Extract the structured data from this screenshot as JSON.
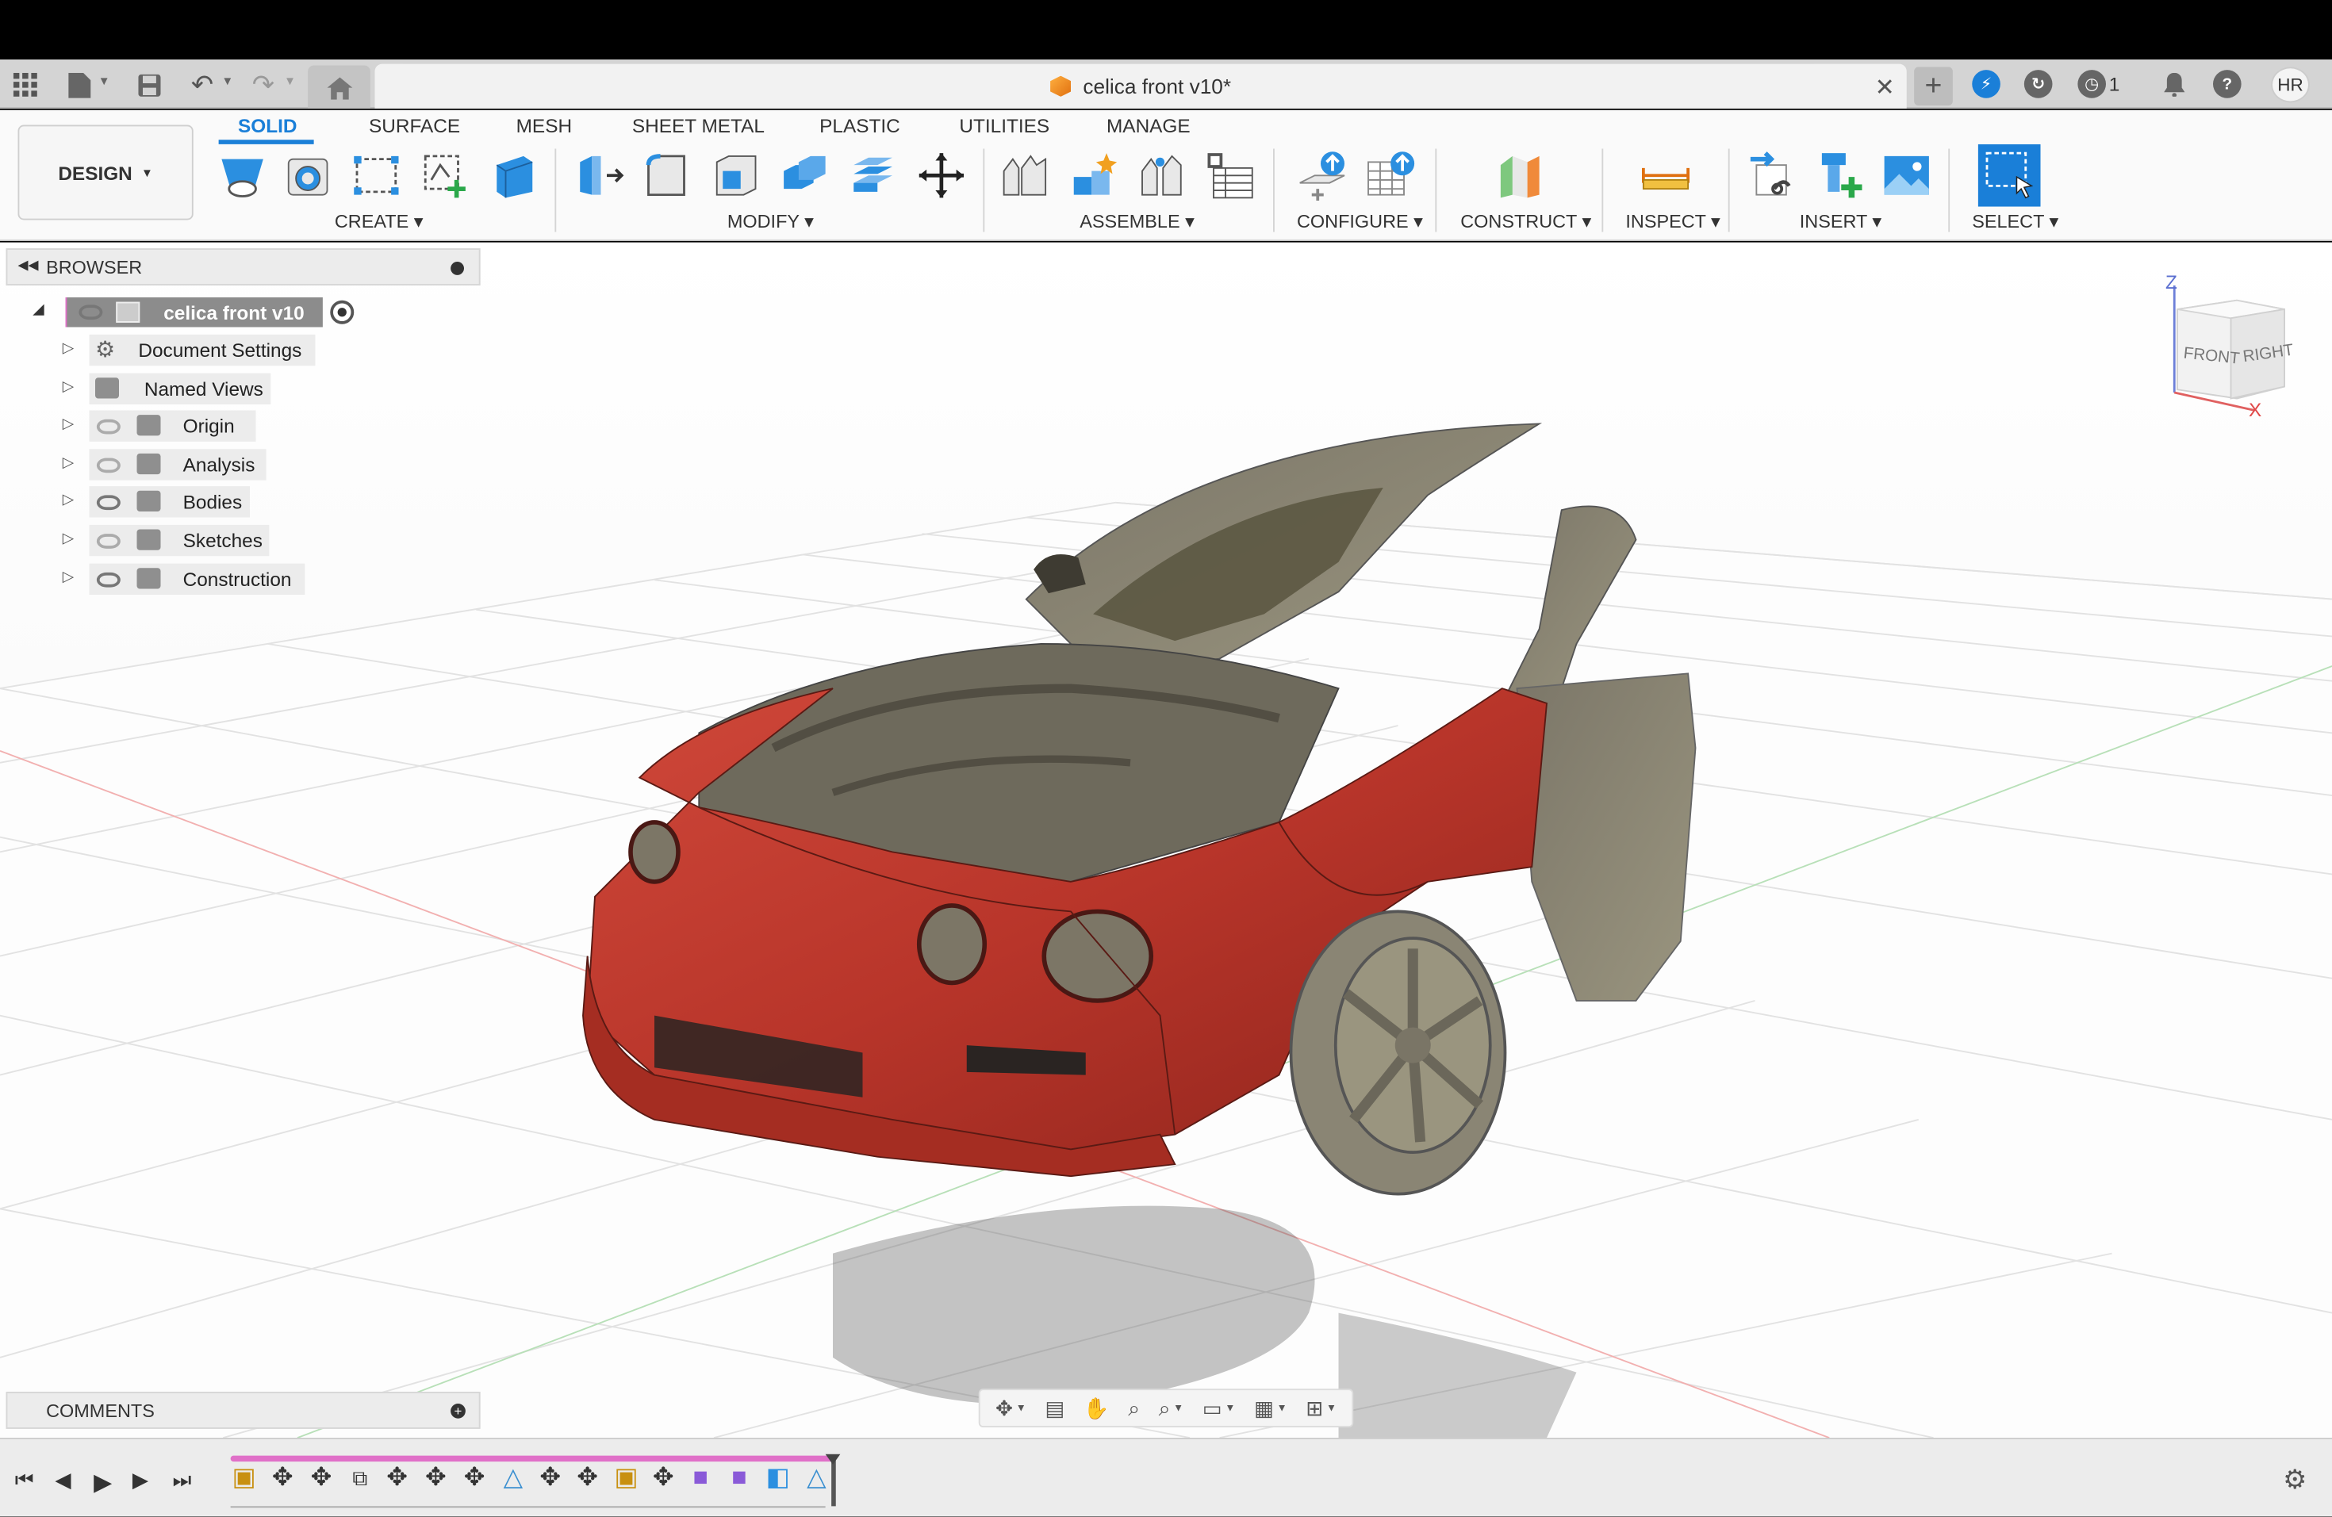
{
  "window": {
    "document_title": "celica front v10*",
    "job_count": "1",
    "avatar_initials": "HR"
  },
  "toolbar": {
    "workspace_label": "DESIGN",
    "tabs": [
      "SOLID",
      "SURFACE",
      "MESH",
      "SHEET METAL",
      "PLASTIC",
      "UTILITIES",
      "MANAGE"
    ],
    "active_tab": "SOLID",
    "groups": {
      "create": "CREATE",
      "modify": "MODIFY",
      "assemble": "ASSEMBLE",
      "configure": "CONFIGURE",
      "construct": "CONSTRUCT",
      "inspect": "INSPECT",
      "insert": "INSERT",
      "select": "SELECT"
    }
  },
  "browser": {
    "title": "BROWSER",
    "root": "celica front v10",
    "items": [
      "Document Settings",
      "Named Views",
      "Origin",
      "Analysis",
      "Bodies",
      "Sketches",
      "Construction"
    ]
  },
  "comments": {
    "title": "COMMENTS"
  },
  "viewcube": {
    "front": "FRONT",
    "right": "RIGHT",
    "axis_z": "Z",
    "axis_x": "X"
  },
  "colors": {
    "accent": "#1a7fd8",
    "timeline_bar": "#e070c8",
    "car_body": "#b8352a",
    "mesh_scan": "#8a8574"
  }
}
